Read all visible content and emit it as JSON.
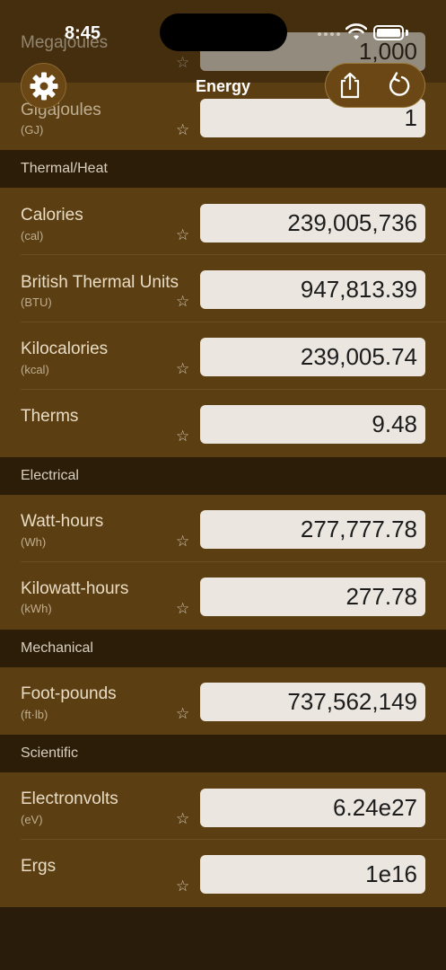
{
  "status": {
    "time": "8:45"
  },
  "nav": {
    "title": "Energy"
  },
  "partial_rows": [
    {
      "name": "Megajoules",
      "value": "1,000"
    },
    {
      "name": "Gigajoules",
      "abbr": "(GJ)",
      "value": "1"
    }
  ],
  "sections": [
    {
      "title": "Thermal/Heat",
      "rows": [
        {
          "name": "Calories",
          "abbr": "(cal)",
          "value": "239,005,736"
        },
        {
          "name": "British Thermal Units",
          "abbr": "(BTU)",
          "value": "947,813.39"
        },
        {
          "name": "Kilocalories",
          "abbr": "(kcal)",
          "value": "239,005.74"
        },
        {
          "name": "Therms",
          "abbr": "",
          "value": "9.48"
        }
      ]
    },
    {
      "title": "Electrical",
      "rows": [
        {
          "name": "Watt-hours",
          "abbr": "(Wh)",
          "value": "277,777.78"
        },
        {
          "name": "Kilowatt-hours",
          "abbr": "(kWh)",
          "value": "277.78"
        }
      ]
    },
    {
      "title": "Mechanical",
      "rows": [
        {
          "name": "Foot-pounds",
          "abbr": "(ft·lb)",
          "value": "737,562,149"
        }
      ]
    },
    {
      "title": "Scientific",
      "rows": [
        {
          "name": "Electronvolts",
          "abbr": "(eV)",
          "value": "6.24e27"
        },
        {
          "name": "Ergs",
          "abbr": "",
          "value": "1e16"
        }
      ]
    }
  ],
  "icons": {
    "settings": "gear-icon",
    "share": "share-icon",
    "reset": "reset-icon",
    "favorite": "star-outline-icon"
  },
  "colors": {
    "row_background": "#5c3e13",
    "section_background": "#2c1d08",
    "value_field": "#ebe7e0"
  }
}
